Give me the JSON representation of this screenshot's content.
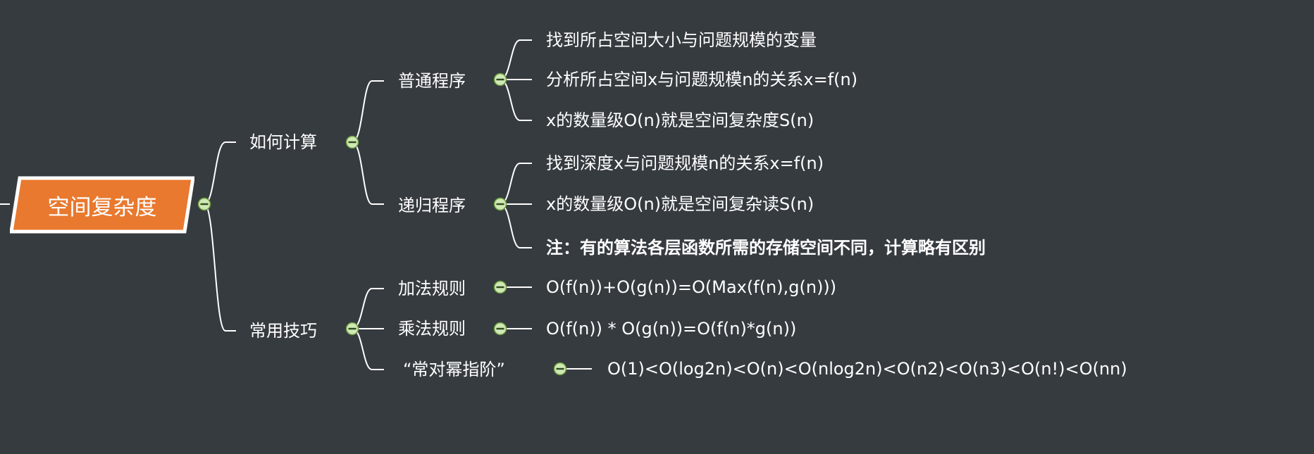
{
  "root": {
    "label": "空间复杂度"
  },
  "branch_calc": {
    "label": "如何计算",
    "normal": {
      "label": "普通程序",
      "items": [
        "找到所占空间大小与问题规模的变量",
        "分析所占空间x与问题规模n的关系x=f(n)",
        "x的数量级O(n)就是空间复杂度S(n)"
      ]
    },
    "recursive": {
      "label": "递归程序",
      "items": [
        "找到深度x与问题规模n的关系x=f(n)",
        "x的数量级O(n)就是空间复杂读S(n)",
        "注：有的算法各层函数所需的存储空间不同，计算略有区别"
      ]
    }
  },
  "branch_tips": {
    "label": "常用技巧",
    "add_rule": {
      "label": "加法规则",
      "value": "O(f(n))+O(g(n))=O(Max(f(n),g(n)))"
    },
    "mul_rule": {
      "label": "乘法规则",
      "value": "O(f(n)) * O(g(n))=O(f(n)*g(n))"
    },
    "order_rule": {
      "label": "“常对幂指阶”",
      "value": "O(1)<O(log2n)<O(n)<O(nlog2n)<O(n2)<O(n3)<O(n!)<O(nn)"
    }
  },
  "colors": {
    "background": "#363b40",
    "root_fill": "#e8792f",
    "root_border": "#ffffff",
    "line": "#ffffff",
    "toggle_fill": "#cfe8b4",
    "toggle_stroke": "#6a9c3c"
  }
}
